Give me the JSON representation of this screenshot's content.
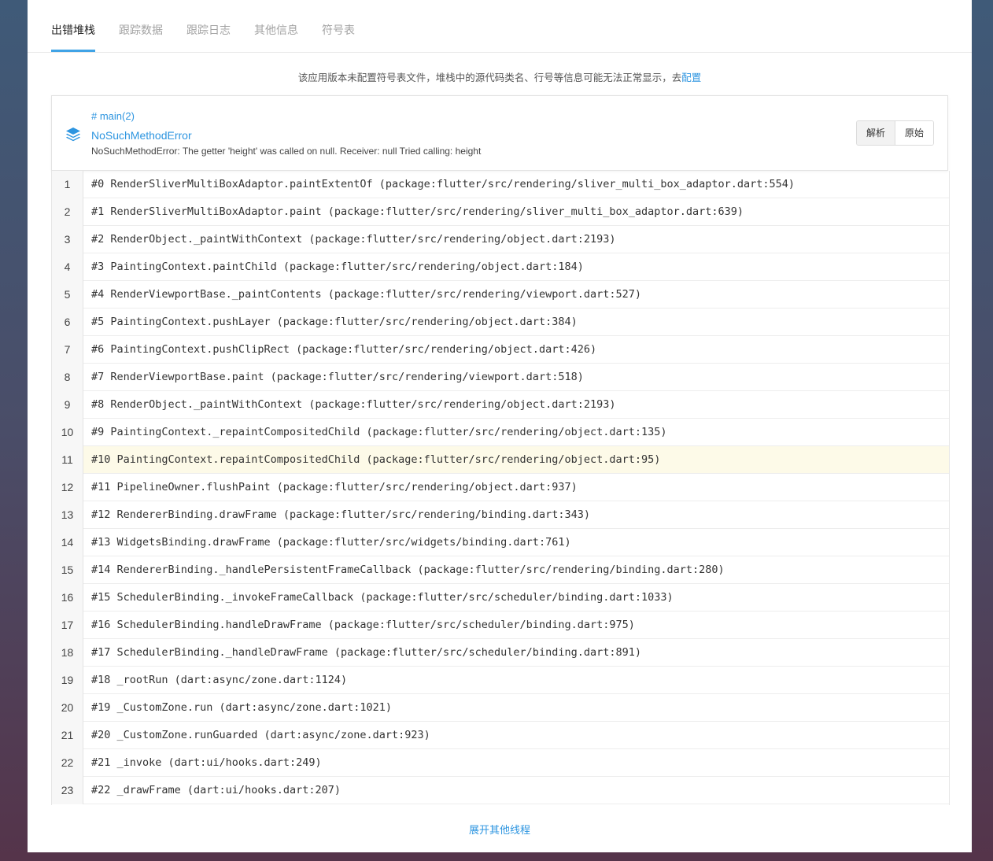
{
  "tabs": [
    {
      "label": "出错堆栈",
      "active": true
    },
    {
      "label": "跟踪数据",
      "active": false
    },
    {
      "label": "跟踪日志",
      "active": false
    },
    {
      "label": "其他信息",
      "active": false
    },
    {
      "label": "符号表",
      "active": false
    }
  ],
  "notice": {
    "text": "该应用版本未配置符号表文件，堆栈中的源代码类名、行号等信息可能无法正常显示，去",
    "link": "配置"
  },
  "thread": {
    "name": "# main(2)",
    "error_type": "NoSuchMethodError",
    "error_message": "NoSuchMethodError: The getter 'height' was called on null. Receiver: null Tried calling: height",
    "icon": "layers-icon"
  },
  "view_toggle": {
    "parsed_label": "解析",
    "raw_label": "原始",
    "selected": "解析"
  },
  "frames": [
    {
      "line": "1",
      "text": "#0 RenderSliverMultiBoxAdaptor.paintExtentOf (package:flutter/src/rendering/sliver_multi_box_adaptor.dart:554)"
    },
    {
      "line": "2",
      "text": "#1 RenderSliverMultiBoxAdaptor.paint (package:flutter/src/rendering/sliver_multi_box_adaptor.dart:639)"
    },
    {
      "line": "3",
      "text": "#2 RenderObject._paintWithContext (package:flutter/src/rendering/object.dart:2193)"
    },
    {
      "line": "4",
      "text": "#3 PaintingContext.paintChild (package:flutter/src/rendering/object.dart:184)"
    },
    {
      "line": "5",
      "text": "#4 RenderViewportBase._paintContents (package:flutter/src/rendering/viewport.dart:527)"
    },
    {
      "line": "6",
      "text": "#5 PaintingContext.pushLayer (package:flutter/src/rendering/object.dart:384)"
    },
    {
      "line": "7",
      "text": "#6 PaintingContext.pushClipRect (package:flutter/src/rendering/object.dart:426)"
    },
    {
      "line": "8",
      "text": "#7 RenderViewportBase.paint (package:flutter/src/rendering/viewport.dart:518)"
    },
    {
      "line": "9",
      "text": "#8 RenderObject._paintWithContext (package:flutter/src/rendering/object.dart:2193)"
    },
    {
      "line": "10",
      "text": "#9 PaintingContext._repaintCompositedChild (package:flutter/src/rendering/object.dart:135)"
    },
    {
      "line": "11",
      "text": "#10 PaintingContext.repaintCompositedChild (package:flutter/src/rendering/object.dart:95)",
      "highlight": true
    },
    {
      "line": "12",
      "text": "#11 PipelineOwner.flushPaint (package:flutter/src/rendering/object.dart:937)"
    },
    {
      "line": "13",
      "text": "#12 RendererBinding.drawFrame (package:flutter/src/rendering/binding.dart:343)"
    },
    {
      "line": "14",
      "text": "#13 WidgetsBinding.drawFrame (package:flutter/src/widgets/binding.dart:761)"
    },
    {
      "line": "15",
      "text": "#14 RendererBinding._handlePersistentFrameCallback (package:flutter/src/rendering/binding.dart:280)"
    },
    {
      "line": "16",
      "text": "#15 SchedulerBinding._invokeFrameCallback (package:flutter/src/scheduler/binding.dart:1033)"
    },
    {
      "line": "17",
      "text": "#16 SchedulerBinding.handleDrawFrame (package:flutter/src/scheduler/binding.dart:975)"
    },
    {
      "line": "18",
      "text": "#17 SchedulerBinding._handleDrawFrame (package:flutter/src/scheduler/binding.dart:891)"
    },
    {
      "line": "19",
      "text": "#18 _rootRun (dart:async/zone.dart:1124)"
    },
    {
      "line": "20",
      "text": "#19 _CustomZone.run (dart:async/zone.dart:1021)"
    },
    {
      "line": "21",
      "text": "#20 _CustomZone.runGuarded (dart:async/zone.dart:923)"
    },
    {
      "line": "22",
      "text": "#21 _invoke (dart:ui/hooks.dart:249)"
    },
    {
      "line": "23",
      "text": "#22 _drawFrame (dart:ui/hooks.dart:207)"
    }
  ],
  "expand_label": "展开其他线程",
  "colors": {
    "accent": "#2d95e0",
    "tab_underline": "#40a3e6",
    "highlight_row": "#fdfae8"
  }
}
